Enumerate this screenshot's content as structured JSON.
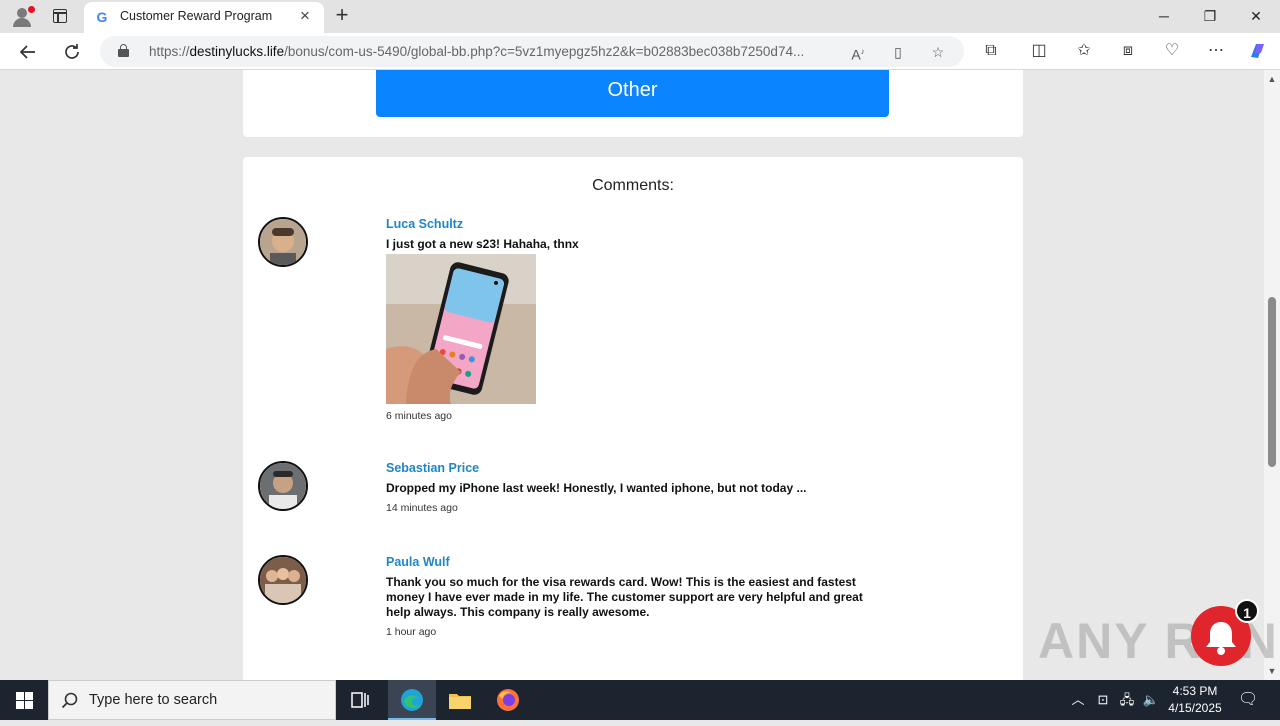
{
  "browser": {
    "tab_title": "Customer Reward Program",
    "tab_favicon": "G",
    "url_prefix": "https://",
    "url_host": "destinylucks.life",
    "url_rest": "/bonus/com-us-5490/global-bb.php?c=5vz1myepgz5hz2&k=b02883bec038b7250d74...",
    "window_controls": {
      "minimize": "─",
      "restore": "❐",
      "close": "✕"
    },
    "icons": {
      "back": "arrow-left-icon",
      "refresh": "refresh-icon",
      "read_aloud": "read-aloud-icon",
      "immersive_reader": "immersive-reader-icon",
      "favorite": "star-icon",
      "extensions": "puzzle-icon",
      "split_screen": "split-screen-icon",
      "favorites": "favorites-icon",
      "collections": "collections-icon",
      "browser_essentials": "heart-pulse-icon",
      "more": "more-icon",
      "copilot": "copilot-icon"
    }
  },
  "page": {
    "other_button_label": "Other",
    "comments_title": "Comments:",
    "comments": [
      {
        "name": "Luca Schultz",
        "text": "I just got a new s23! Hahaha, thnx",
        "time": "6 minutes ago",
        "has_image": true
      },
      {
        "name": "Sebastian Price",
        "text": "Dropped my iPhone last week! Honestly, I wanted iphone, but not today ...",
        "time": "14 minutes ago"
      },
      {
        "name": "Paula Wulf",
        "text": "Thank you so much for the visa rewards card. Wow! This is the easiest and fastest money I have ever made in my life. The customer support are very helpful and great help always. This company is really awesome.",
        "time": "1 hour ago"
      }
    ],
    "notification_count": "1",
    "watermark": "ANY RUN"
  },
  "taskbar": {
    "search_placeholder": "Type here to search",
    "time": "4:53 PM",
    "date": "4/15/2025"
  },
  "colors": {
    "primary_button": "#0a84ff",
    "comment_name": "#1f86c8",
    "bell": "#e0262c",
    "taskbar": "#1c2430"
  }
}
